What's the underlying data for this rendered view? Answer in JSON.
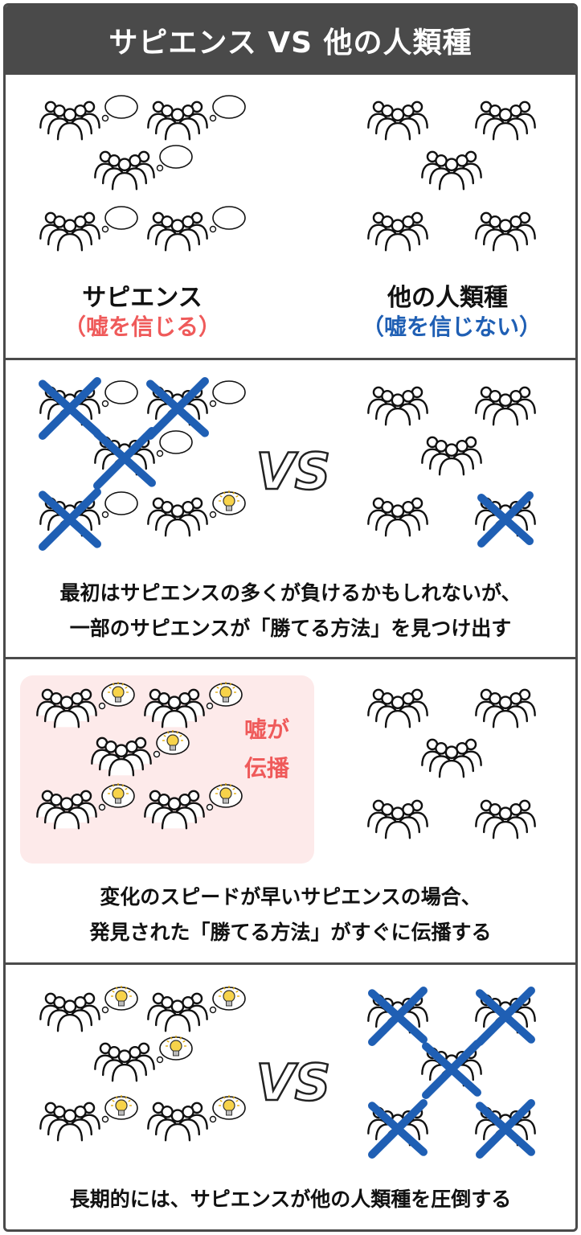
{
  "title": "サピエンス VS 他の人類種",
  "panel1": {
    "sapiens_label": "サピエンス",
    "sapiens_note": "（嘘を信じる）",
    "others_label": "他の人類種",
    "others_note": "（嘘を信じない）"
  },
  "panel2": {
    "vs": "VS",
    "caption_line1": "最初はサピエンスの多くが負けるかもしれないが、",
    "caption_line2": "一部のサピエンスが「勝てる方法」を見つけ出す"
  },
  "panel3": {
    "spread_label_line1": "嘘が",
    "spread_label_line2": "伝播",
    "caption_line1": "変化のスピードが早いサピエンスの場合、",
    "caption_line2": "発見された「勝てる方法」がすぐに伝播する"
  },
  "panel4": {
    "vs": "VS",
    "caption_line1": "長期的には、サピエンスが他の人類種を圧倒する"
  },
  "colors": {
    "header_bg": "#4a4a4a",
    "cross": "#1f5fb4",
    "sapiens_note": "#ef5a5a",
    "others_note": "#1f5fb4",
    "highlight_bg": "#fdeaea",
    "bulb": "#f7d34a"
  },
  "icons": [
    "group-of-people-icon",
    "speech-bubble-icon",
    "lightbulb-bubble-icon",
    "cross-mark-icon",
    "vs-outline-icon"
  ]
}
